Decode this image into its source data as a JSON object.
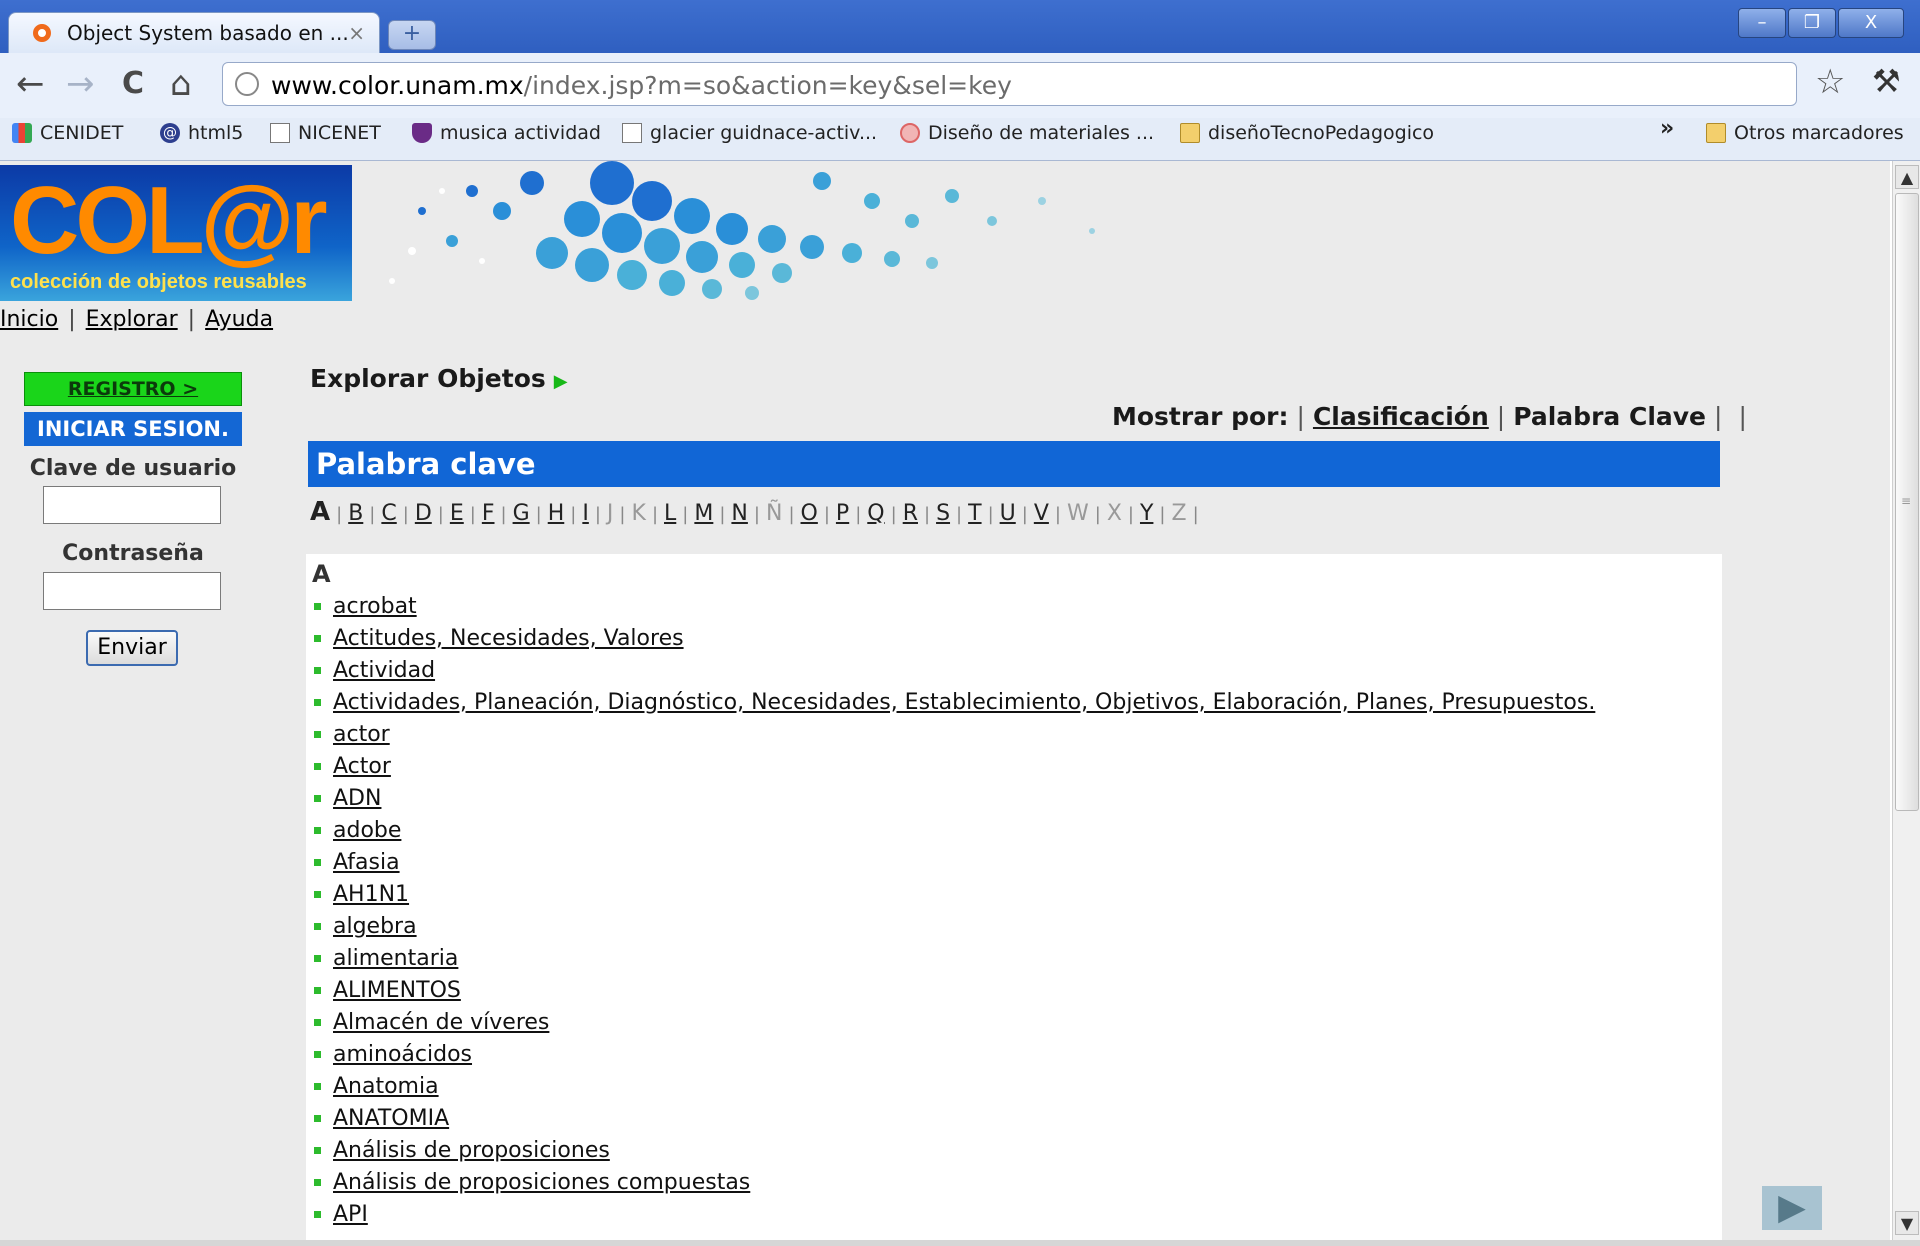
{
  "browser": {
    "tab_title": "Object System basado en ...",
    "tab_close": "×",
    "new_tab": "+",
    "window_buttons": [
      "–",
      "❐",
      "X"
    ],
    "url_host": "www.color.unam.mx",
    "url_path": "/index.jsp?m=so&action=key&sel=key",
    "nav": {
      "back": "←",
      "forward": "→",
      "reload": "C",
      "home": "⌂"
    },
    "star": "☆",
    "wrench": "🔧",
    "bookmarks": [
      {
        "label": "CENIDET",
        "icon": "google-icon"
      },
      {
        "label": "html5",
        "icon": "at-icon"
      },
      {
        "label": "NICENET",
        "icon": "page-icon"
      },
      {
        "label": "musica actividad",
        "icon": "shield-icon"
      },
      {
        "label": "glacier guidnace-activ...",
        "icon": "page-icon"
      },
      {
        "label": "Diseño de materiales ...",
        "icon": "flower-icon"
      },
      {
        "label": "diseñoTecnoPedagogico",
        "icon": "folder-icon"
      }
    ],
    "bookmarks_more": "»",
    "other_bookmarks": "Otros marcadores"
  },
  "logo": {
    "text": "COL@r",
    "subtitle": "colección de objetos reusables"
  },
  "topnav": {
    "inicio": "Inicio",
    "explorar": "Explorar",
    "ayuda": "Ayuda",
    "sep": "|"
  },
  "sidebar": {
    "registro": "REGISTRO >",
    "iniciar": "INICIAR SESION.",
    "user_label": "Clave de usuario",
    "password_label": "Contraseña",
    "submit": "Enviar"
  },
  "main": {
    "explorar_title": "Explorar Objetos",
    "explorar_arrow": "▶",
    "mostrar_label": "Mostrar por:",
    "mostrar_clasificacion": "Clasificación",
    "mostrar_palabra": "Palabra Clave",
    "section_title": "Palabra clave",
    "current_letter": "A",
    "alphabet": [
      {
        "l": "B",
        "on": true
      },
      {
        "l": "C",
        "on": true
      },
      {
        "l": "D",
        "on": true
      },
      {
        "l": "E",
        "on": true
      },
      {
        "l": "F",
        "on": true
      },
      {
        "l": "G",
        "on": true
      },
      {
        "l": "H",
        "on": true
      },
      {
        "l": "I",
        "on": true
      },
      {
        "l": "J",
        "on": false
      },
      {
        "l": "K",
        "on": false
      },
      {
        "l": "L",
        "on": true
      },
      {
        "l": "M",
        "on": true
      },
      {
        "l": "N",
        "on": true
      },
      {
        "l": "Ñ",
        "on": false
      },
      {
        "l": "O",
        "on": true
      },
      {
        "l": "P",
        "on": true
      },
      {
        "l": "Q",
        "on": true
      },
      {
        "l": "R",
        "on": true
      },
      {
        "l": "S",
        "on": true
      },
      {
        "l": "T",
        "on": true
      },
      {
        "l": "U",
        "on": true
      },
      {
        "l": "V",
        "on": true
      },
      {
        "l": "W",
        "on": false
      },
      {
        "l": "X",
        "on": false
      },
      {
        "l": "Y",
        "on": true
      },
      {
        "l": "Z",
        "on": false
      }
    ],
    "list_letter": "A",
    "keywords": [
      "acrobat",
      "Actitudes, Necesidades, Valores",
      "Actividad",
      "Actividades, Planeación, Diagnóstico, Necesidades, Establecimiento, Objetivos, Elaboración, Planes, Presupuestos.",
      "actor",
      "Actor",
      "ADN",
      "adobe",
      "Afasia",
      "AH1N1",
      "algebra",
      "alimentaria",
      "ALIMENTOS",
      "Almacén de víveres",
      "aminoácidos",
      "Anatomia",
      "ANATOMIA",
      "Análisis de proposiciones",
      "Análisis de proposiciones compuestas",
      "API"
    ]
  },
  "scrollbar": {
    "up": "▲",
    "down": "▼",
    "grip": "≡"
  },
  "play": "▶"
}
